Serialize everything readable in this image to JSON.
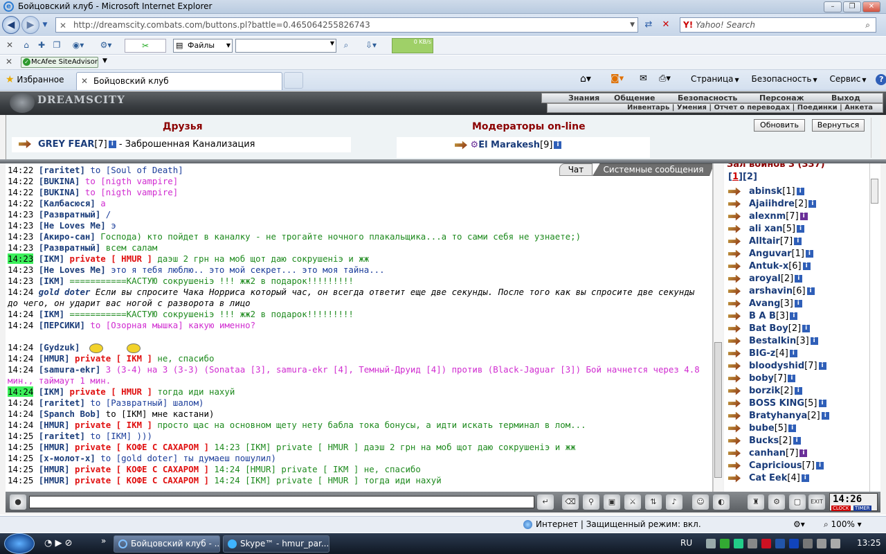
{
  "window": {
    "title": "Бойцовский клуб - Microsoft Internet Explorer"
  },
  "nav": {
    "address": "http://dreamscity.combats.com/buttons.pl?battle=0.465064255826743",
    "search_placeholder": "Yahoo! Search"
  },
  "toolbar": {
    "files_label": "Файлы",
    "speed": "0 KB/s",
    "mcafee": "McAfee SiteAdvisor"
  },
  "tabs": {
    "favorites": "Избранное",
    "active_tab": "Бойцовский клуб",
    "tools": [
      "Страница",
      "Безопасность",
      "Сервис"
    ]
  },
  "game": {
    "logo": "DREAMSCITY",
    "menu_top": [
      "Знания",
      "Общение",
      "Безопасность",
      "Персонаж",
      "Выход"
    ],
    "menu_sub": "Инвентарь | Умения | Отчет о переводах | Поединки | Анкета",
    "friends_title": "Друзья",
    "moderators_title": "Модераторы on-line",
    "refresh_button": "Обновить",
    "back_button": "Вернуться",
    "friend": {
      "name": "GREY FEAR",
      "level": "[7]",
      "location": "- Заброшенная Канализация"
    },
    "moderator": {
      "name": "El Marakesh",
      "level": "[9]"
    },
    "chat_tab": "Чат",
    "system_tab": "Системные сообщения"
  },
  "chat": [
    {
      "time": "14:22",
      "nick": "[raritet]",
      "body": " to [Soul of Death]",
      "color": "c-blue"
    },
    {
      "time": "14:22",
      "nick": "[BUKINA]",
      "body": " to [nigth vampire]",
      "color": "c-mag"
    },
    {
      "time": "14:22",
      "nick": "[BUKINA]",
      "body": " to [nigth vampire]",
      "color": "c-mag"
    },
    {
      "time": "14:22",
      "nick": "[Калбасюся]",
      "body": " а",
      "color": "c-mag"
    },
    {
      "time": "14:23",
      "nick": "[Развратный]",
      "body": " /",
      "color": "c-blue"
    },
    {
      "time": "14:23",
      "nick": "[He Loves Me]",
      "body": " э",
      "color": "c-blue"
    },
    {
      "time": "14:23",
      "nick": "[Акиро-сан]",
      "body": " Господа) кто пойдет в каналку - не трогайте ночного плакальщика...а то сами себя не узнаете;)",
      "color": "c-grn"
    },
    {
      "time": "14:23",
      "nick": "[Развратный]",
      "body": " всем салам",
      "color": "c-grn"
    },
    {
      "time": "14:23",
      "hl": true,
      "nick": "[IKM]",
      "priv": " private [ HMUR ]",
      "body": " даэш 2 грн на моб щот даю сокрушеніэ и жж",
      "color": "c-grn"
    },
    {
      "time": "14:23",
      "nick": "[He Loves Me]",
      "body": " это я тебя люблю.. это мой секрет... это моя тайна...",
      "color": "c-blue"
    },
    {
      "time": "14:23",
      "nick": "[IKM]",
      "body": " ===========КАСТУЮ сокрушеніэ !!! жж2 в подарок!!!!!!!!!",
      "color": "c-grn"
    },
    {
      "time": "14:24",
      "nick": "gold doter",
      "italic": true,
      "body": " Если вы спросите Чака Норриса который час, он всегда ответит еще две секунды. После того как вы спросите две секунды до чего, он ударит вас ногой с разворота в лицо",
      "color": "c-dk",
      "wrap": true
    },
    {
      "time": "14:24",
      "nick": "[IKM]",
      "body": " ===========КАСТУЮ сокрушеніэ !!! жж2 в подарок!!!!!!!!!",
      "color": "c-grn"
    },
    {
      "time": "14:24",
      "nick": "[ПЕРСИКИ]",
      "body": " to [Озорная мышка] какую именно?",
      "color": "c-mag"
    },
    {
      "time": "",
      "nick": "",
      "body": "",
      "color": "c-dk"
    },
    {
      "time": "14:24",
      "nick": "[Gydzuk]",
      "body": "",
      "color": "c-dk",
      "smiles": true
    },
    {
      "time": "14:24",
      "nick": "[HMUR]",
      "priv": " private [ IKM ]",
      "body": " не, спасибо",
      "color": "c-grn"
    },
    {
      "time": "14:24",
      "nick": "[samura-ekr]",
      "body": " 3 (3-4) на 3 (3-3) (Sonataa [3], samura-ekr [4], Темный-Друид [4]) против (Black-Jaguar [3]) Бой начнется через 4.8 мин., таймаут 1 мин.",
      "color": "c-mag",
      "wrap": true
    },
    {
      "time": "14:24",
      "hl": true,
      "nick": "[IKM]",
      "priv": " private [ HMUR ]",
      "body": " тогда иди нахуй",
      "color": "c-grn"
    },
    {
      "time": "14:24",
      "nick": "[raritet]",
      "body": " to [Развратный] шалом)",
      "color": "c-blue"
    },
    {
      "time": "14:24",
      "nick": "[Spanch Bob]",
      "body": " to [IKM] мне кастани)",
      "color": "c-dk"
    },
    {
      "time": "14:24",
      "nick": "[HMUR]",
      "priv": " private [ IKM ]",
      "body": " просто щас на основном щету нету бабла тока бонусы, а идти искать терминал в лом...",
      "color": "c-grn"
    },
    {
      "time": "14:25",
      "nick": "[raritet]",
      "body": " to [IKM] )))",
      "color": "c-blue"
    },
    {
      "time": "14:25",
      "nick": "[HMUR]",
      "priv": " private [ КОФЕ С САХАРОМ ]",
      "body": " 14:23 [IKM] private [ HMUR ] даэш 2 грн на моб щот даю сокрушеніэ и жж",
      "color": "c-grn"
    },
    {
      "time": "14:25",
      "nick": "[x-молот-x]",
      "body": " to [gold doter] ты думаеш пошулил)",
      "color": "c-blue"
    },
    {
      "time": "14:25",
      "nick": "[HMUR]",
      "priv": " private [ КОФЕ С САХАРОМ ]",
      "body": " 14:24 [HMUR] private [ IKM ] не, спасибо",
      "color": "c-grn"
    },
    {
      "time": "14:25",
      "nick": "[HMUR]",
      "priv": " private [ КОФЕ С САХАРОМ ]",
      "body": " 14:24 [IKM] private [ HMUR ] тогда иди нахуй",
      "color": "c-grn"
    }
  ],
  "users": {
    "header": "Зал воинов 3 (337)",
    "pages": [
      "1",
      "2"
    ],
    "list": [
      {
        "name": "abinsk",
        "level": "[1]"
      },
      {
        "name": "Ajaiihdre",
        "level": "[2]"
      },
      {
        "name": "alexnm",
        "level": "[7]",
        "info": "pur"
      },
      {
        "name": "ali xan",
        "level": "[5]"
      },
      {
        "name": "Alltair",
        "level": "[7]"
      },
      {
        "name": "Anguvar",
        "level": "[1]"
      },
      {
        "name": "Antuk-x",
        "level": "[6]"
      },
      {
        "name": "aroyal",
        "level": "[2]"
      },
      {
        "name": "arshavin",
        "level": "[6]"
      },
      {
        "name": "Avang",
        "level": "[3]"
      },
      {
        "name": "B A B",
        "level": "[3]"
      },
      {
        "name": "Bat Boy",
        "level": "[2]"
      },
      {
        "name": "Bestalkin",
        "level": "[3]"
      },
      {
        "name": "BIG-z",
        "level": "[4]"
      },
      {
        "name": "bloodyshid",
        "level": "[7]"
      },
      {
        "name": "boby",
        "level": "[7]"
      },
      {
        "name": "borzik",
        "level": "[2]"
      },
      {
        "name": "BOSS KING",
        "level": "[5]"
      },
      {
        "name": "Bratyhanya",
        "level": "[2]"
      },
      {
        "name": "bube",
        "level": "[5]"
      },
      {
        "name": "Bucks",
        "level": "[2]"
      },
      {
        "name": "canhan",
        "level": "[7]",
        "info": "pur"
      },
      {
        "name": "Capricious",
        "level": "[7]"
      },
      {
        "name": "Cat Eek",
        "level": "[4]"
      }
    ]
  },
  "bottom": {
    "clock": "14:26",
    "clock_label1": "CLOCK",
    "clock_label2": "TIMER"
  },
  "status": {
    "zone": "Интернет | Защищенный режим: вкл.",
    "zoom": "100%"
  },
  "taskbar": {
    "tasks": [
      "Бойцовский клуб - ...",
      "Skype™ - hmur_par..."
    ],
    "lang": "RU",
    "time": "13:25"
  }
}
